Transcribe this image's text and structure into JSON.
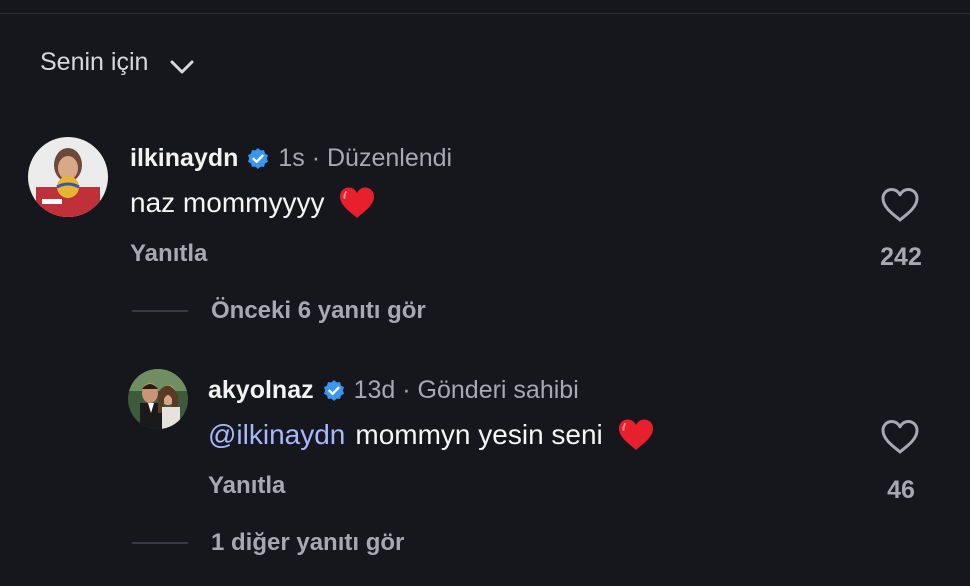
{
  "sort": {
    "label": "Senin için",
    "icon": "chevron-down-icon"
  },
  "comments": [
    {
      "username": "ilkinaydn",
      "verified": true,
      "meta": "1s · Düzenlendi",
      "text": "naz mommyyyy",
      "emoji": "red-heart",
      "reply_label": "Yanıtla",
      "likes": "242",
      "more_replies": "Önceki 6 yanıtı gör"
    }
  ],
  "replies": [
    {
      "username": "akyolnaz",
      "verified": true,
      "meta": "13d · Gönderi sahibi",
      "mention": "@ilkinaydn",
      "text": "mommyn yesin seni",
      "emoji": "red-heart",
      "reply_label": "Yanıtla",
      "likes": "46",
      "more_replies": "1 diğer yanıtı gör"
    }
  ],
  "colors": {
    "background": "#16171c",
    "mention": "#a8b8ff",
    "verified": "#3897f0",
    "muted_text": "#a8a9b0"
  }
}
